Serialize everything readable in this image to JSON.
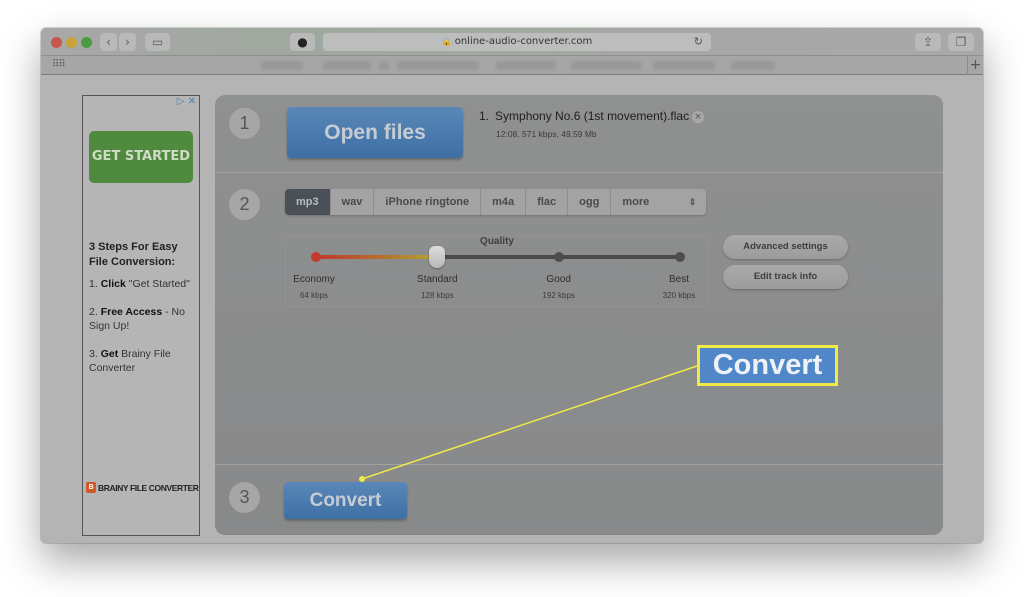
{
  "browser": {
    "url": "online-audio-converter.com",
    "new_tab_label": "+"
  },
  "ad": {
    "cta_label": "GET STARTED",
    "heading": "3 Steps For Easy File Conversion:",
    "steps": [
      {
        "num": "1.",
        "bold": "Click",
        "text": " \"Get Started\""
      },
      {
        "num": "2.",
        "bold": "Free Access",
        "text": " - No Sign Up!"
      },
      {
        "num": "3.",
        "bold": "Get",
        "text": " Brainy File Converter"
      }
    ],
    "brand": "BRAINY FILE CONVERTER",
    "brand_logo": "B"
  },
  "converter": {
    "step1": {
      "number": "1",
      "open_files_label": "Open files",
      "file": {
        "index": "1.",
        "name": "Symphony No.6 (1st movement).flac",
        "meta": "12:08, 571 kbps, 49.59 Mb"
      }
    },
    "step2": {
      "number": "2",
      "formats": [
        "mp3",
        "wav",
        "iPhone ringtone",
        "m4a",
        "flac",
        "ogg"
      ],
      "active_format": "mp3",
      "more_label": "more",
      "quality": {
        "title": "Quality",
        "selected_index": 1,
        "levels": [
          {
            "label": "Economy",
            "rate": "64 kbps"
          },
          {
            "label": "Standard",
            "rate": "128 kbps"
          },
          {
            "label": "Good",
            "rate": "192 kbps"
          },
          {
            "label": "Best",
            "rate": "320 kbps"
          }
        ]
      },
      "advanced_settings_label": "Advanced settings",
      "edit_track_info_label": "Edit track info"
    },
    "step3": {
      "number": "3",
      "convert_label": "Convert"
    }
  },
  "annotation": {
    "callout_label": "Convert",
    "highlight_color": "#f1ea45"
  }
}
